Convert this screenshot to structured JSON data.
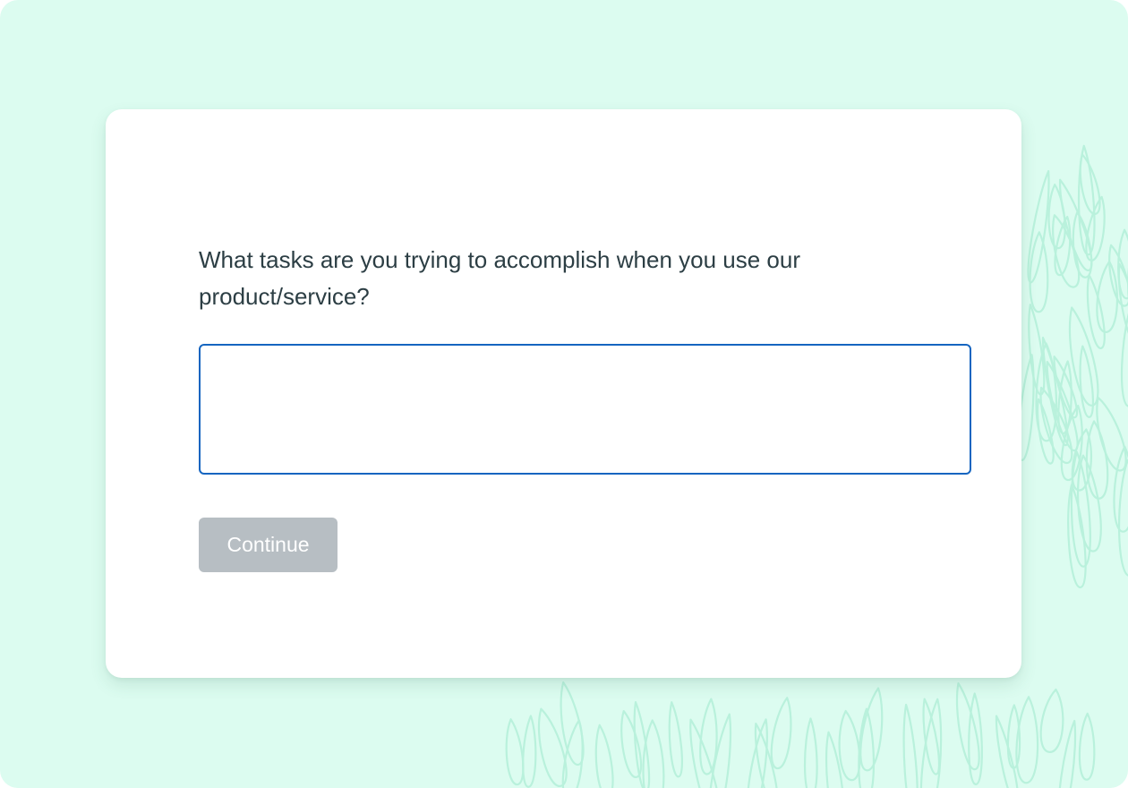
{
  "theme": {
    "background": "#dcfcf0",
    "card": "#ffffff",
    "pattern_stroke": "#b9f1dc",
    "text": "#2c3e44",
    "input_border": "#1565c0",
    "button_disabled": "#b7bec3"
  },
  "survey": {
    "question": "What tasks are you trying to accomplish when you use our product/service?",
    "answer_value": "",
    "continue_label": "Continue",
    "continue_enabled": false
  }
}
